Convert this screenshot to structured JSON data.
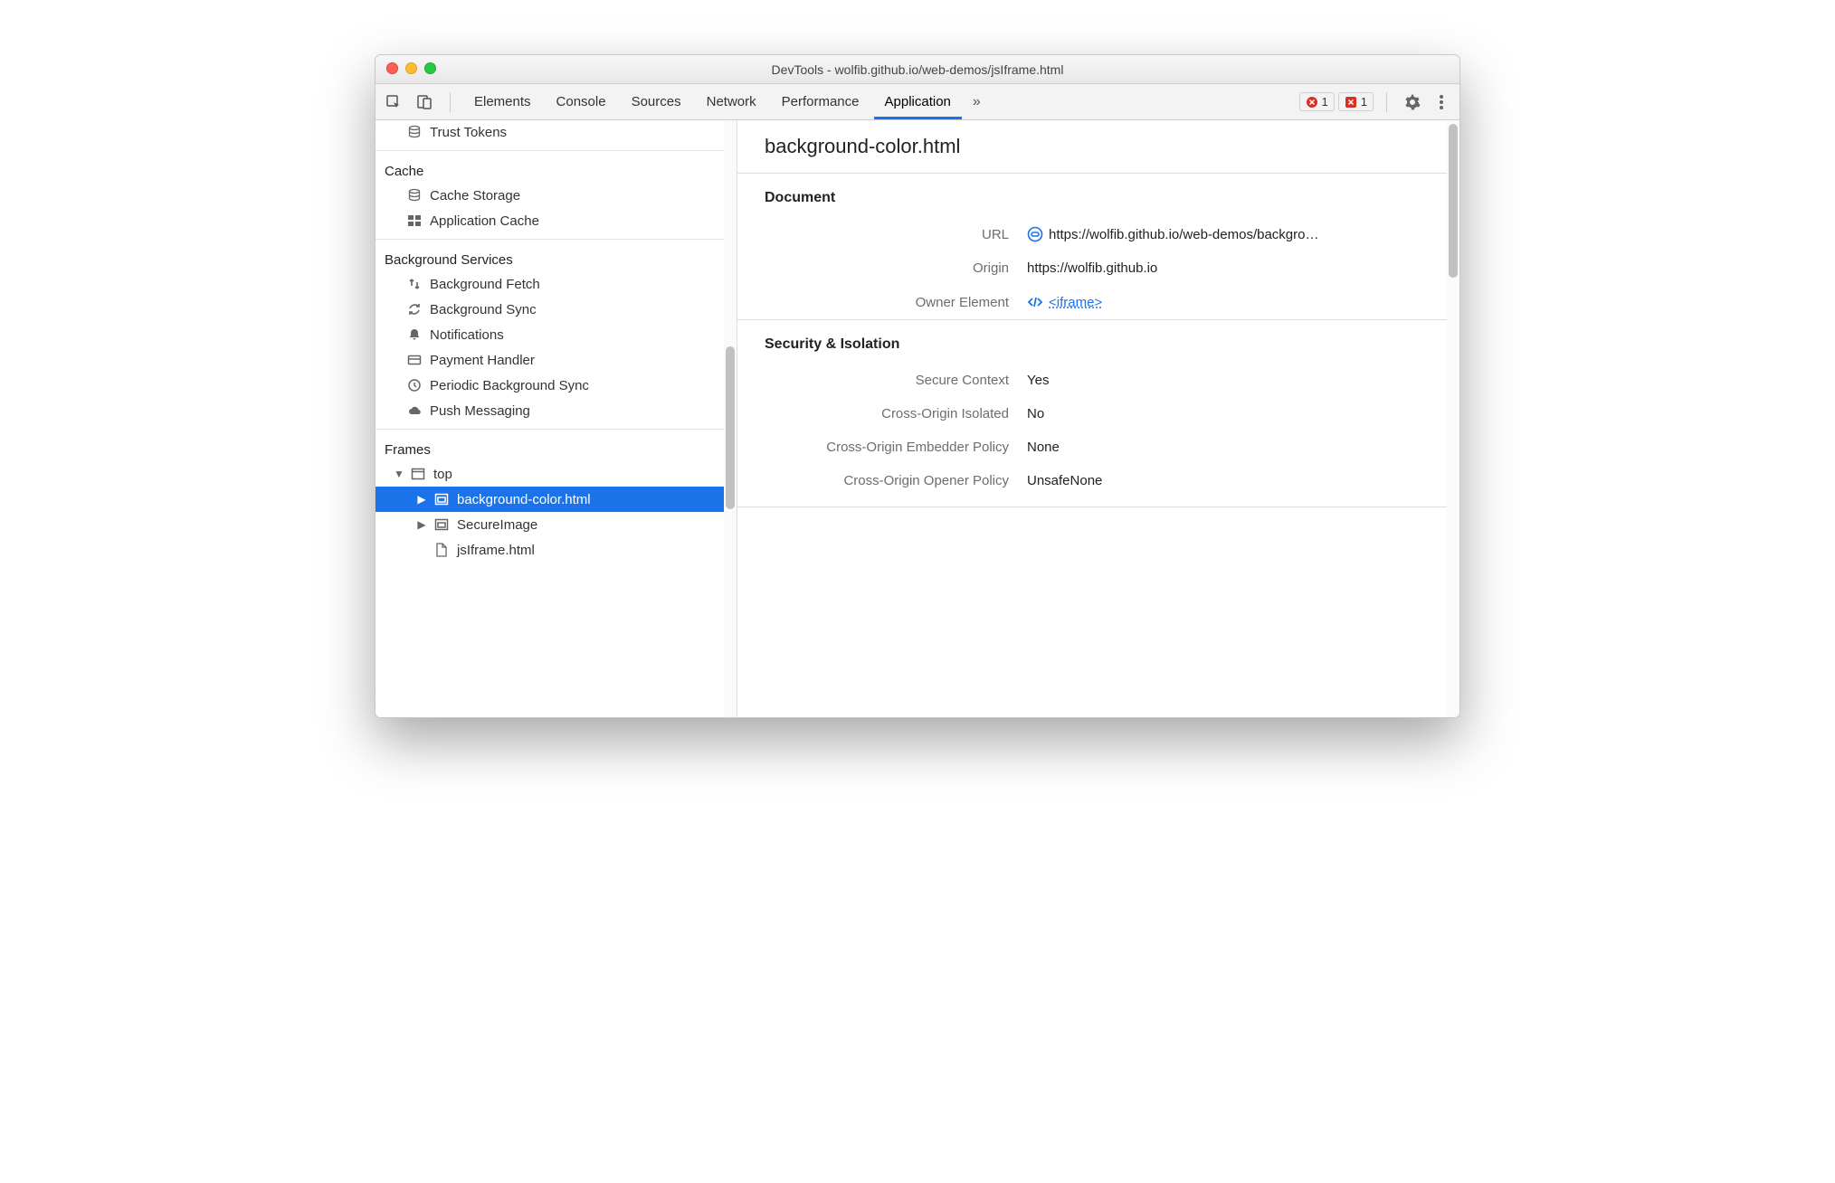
{
  "window": {
    "title": "DevTools - wolfib.github.io/web-demos/jsIframe.html"
  },
  "toolbar": {
    "tabs": [
      "Elements",
      "Console",
      "Sources",
      "Network",
      "Performance",
      "Application"
    ],
    "active_tab_index": 5,
    "error_count": "1",
    "issue_count": "1"
  },
  "sidebar": {
    "top_item": "Trust Tokens",
    "groups": [
      {
        "label": "Cache",
        "items": [
          {
            "icon": "database-icon",
            "label": "Cache Storage"
          },
          {
            "icon": "grid-icon",
            "label": "Application Cache"
          }
        ]
      },
      {
        "label": "Background Services",
        "items": [
          {
            "icon": "transfer-icon",
            "label": "Background Fetch"
          },
          {
            "icon": "sync-icon",
            "label": "Background Sync"
          },
          {
            "icon": "bell-icon",
            "label": "Notifications"
          },
          {
            "icon": "card-icon",
            "label": "Payment Handler"
          },
          {
            "icon": "clock-icon",
            "label": "Periodic Background Sync"
          },
          {
            "icon": "cloud-icon",
            "label": "Push Messaging"
          }
        ]
      }
    ],
    "frames_label": "Frames",
    "frames": {
      "top_label": "top",
      "children": [
        {
          "icon": "embed-icon",
          "label": "background-color.html",
          "expandable": true,
          "selected": true
        },
        {
          "icon": "embed-icon",
          "label": "SecureImage",
          "expandable": true,
          "selected": false
        },
        {
          "icon": "document-icon",
          "label": "jsIframe.html",
          "expandable": false,
          "selected": false
        }
      ]
    }
  },
  "main": {
    "title": "background-color.html",
    "sections": [
      {
        "heading": "Document",
        "rows": [
          {
            "key": "URL",
            "value": "https://wolfib.github.io/web-demos/backgro…",
            "icon": "link-pill-icon",
            "value_link": false
          },
          {
            "key": "Origin",
            "value": "https://wolfib.github.io",
            "value_link": false
          },
          {
            "key": "Owner Element",
            "value": "<iframe>",
            "icon": "code-icon",
            "value_link": true
          }
        ]
      },
      {
        "heading": "Security & Isolation",
        "rows": [
          {
            "key": "Secure Context",
            "value": "Yes"
          },
          {
            "key": "Cross-Origin Isolated",
            "value": "No"
          },
          {
            "key": "Cross-Origin Embedder Policy",
            "value": "None"
          },
          {
            "key": "Cross-Origin Opener Policy",
            "value": "UnsafeNone"
          }
        ]
      }
    ]
  }
}
